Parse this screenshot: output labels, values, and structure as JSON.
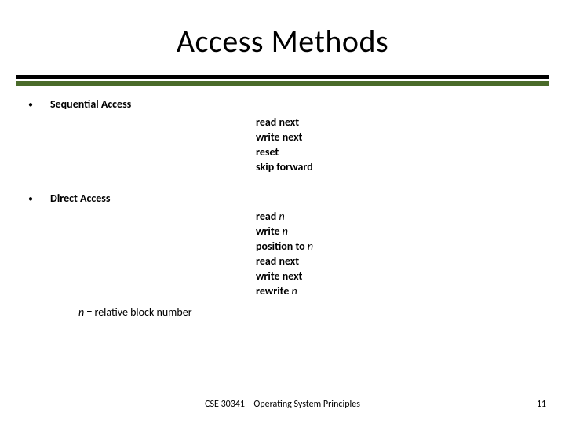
{
  "title": "Access Methods",
  "items": [
    {
      "label": "Sequential Access",
      "ops": [
        "read next",
        "write next",
        "reset",
        "skip forward"
      ]
    },
    {
      "label": "Direct Access",
      "ops": [
        "read n",
        "write n",
        "position to n",
        "read next",
        "write next",
        "rewrite n"
      ],
      "note_prefix": "n",
      "note_rest": " = relative block number"
    }
  ],
  "footer": {
    "course": "CSE 30341 – Operating System Principles",
    "page": "11"
  }
}
